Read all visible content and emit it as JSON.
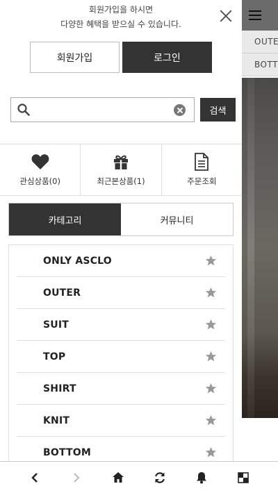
{
  "promo": {
    "line1": "회원가입을 하시면",
    "line2": "다양한 혜택을 받으실 수 있습니다."
  },
  "auth": {
    "signup_label": "회원가입",
    "login_label": "로그인"
  },
  "search": {
    "placeholder": "",
    "value": "",
    "button_label": "검색"
  },
  "shortcuts": [
    {
      "label": "관심상품(0)",
      "icon": "heart-icon"
    },
    {
      "label": "최근본상품(1)",
      "icon": "gift-icon"
    },
    {
      "label": "주문조회",
      "icon": "document-icon"
    }
  ],
  "tabs": [
    {
      "label": "카테고리",
      "active": true
    },
    {
      "label": "커뮤니티",
      "active": false
    }
  ],
  "categories": [
    {
      "label": "ONLY ASCLO"
    },
    {
      "label": "OUTER"
    },
    {
      "label": "SUIT"
    },
    {
      "label": "TOP"
    },
    {
      "label": "SHIRT"
    },
    {
      "label": "KNIT"
    },
    {
      "label": "BOTTOM"
    }
  ],
  "background_page": {
    "menu": [
      "OUTER",
      "BOTTOM"
    ]
  },
  "bottom_nav": [
    "back-icon",
    "forward-icon",
    "home-icon",
    "refresh-icon",
    "bell-icon",
    "tabs-icon"
  ],
  "colors": {
    "dark": "#333333",
    "star": "#999999"
  }
}
